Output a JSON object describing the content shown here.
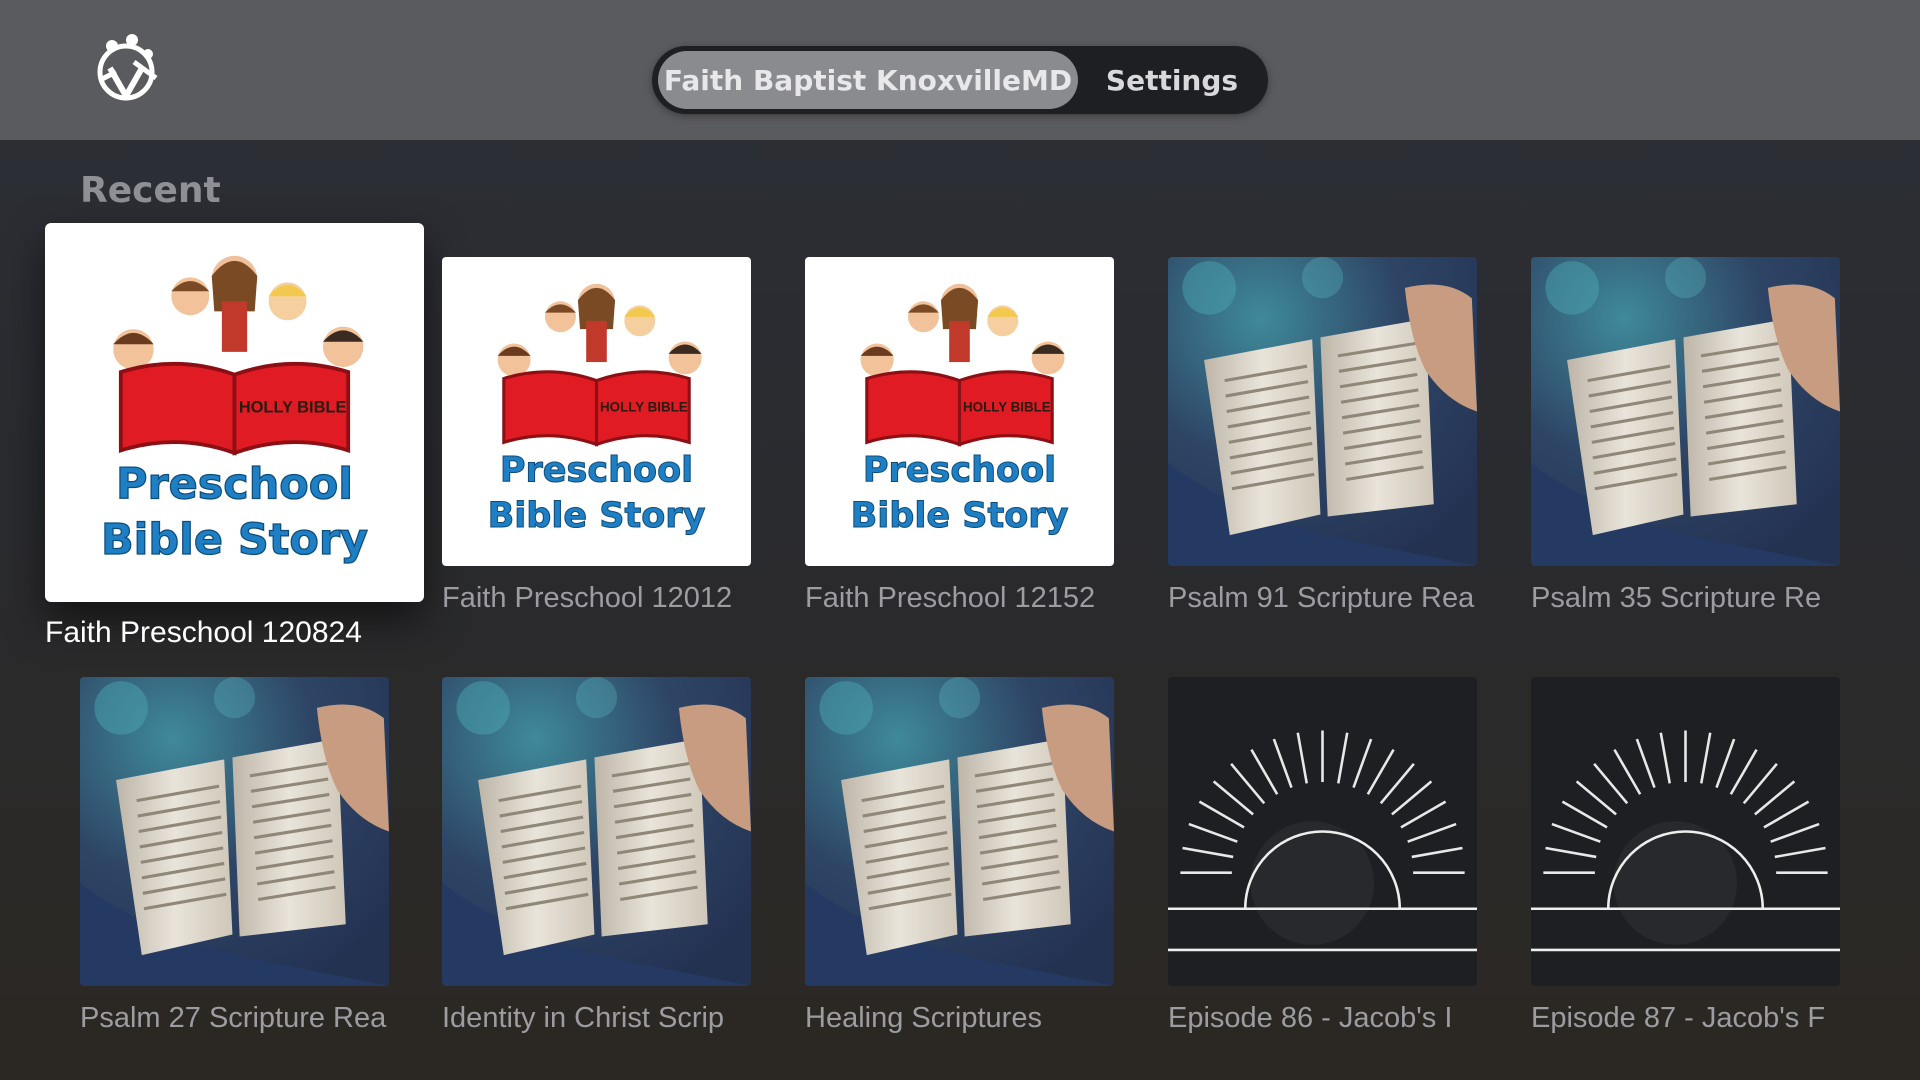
{
  "header": {
    "logo_icon": "church-people-logo-icon",
    "tabs": [
      {
        "label": "Faith Baptist KnoxvilleMD",
        "active": true
      },
      {
        "label": "Settings",
        "active": false
      }
    ]
  },
  "section": {
    "title": "Recent"
  },
  "items": [
    {
      "title": "Faith Preschool 120824",
      "art": "preschool",
      "art_line1": "Preschool",
      "art_line2": "Bible Story",
      "art_book": "HOLLY BIBLE",
      "focused": true
    },
    {
      "title": "Faith Preschool 12012",
      "art": "preschool",
      "art_line1": "Preschool",
      "art_line2": "Bible Story",
      "art_book": "HOLLY BIBLE",
      "focused": false
    },
    {
      "title": "Faith Preschool 12152",
      "art": "preschool",
      "art_line1": "Preschool",
      "art_line2": "Bible Story",
      "art_book": "HOLLY BIBLE",
      "focused": false
    },
    {
      "title": "Psalm 91 Scripture Rea",
      "art": "bible-photo",
      "focused": false
    },
    {
      "title": "Psalm 35 Scripture Re",
      "art": "bible-photo",
      "focused": false
    },
    {
      "title": "Psalm 27 Scripture Rea",
      "art": "bible-photo",
      "focused": false
    },
    {
      "title": "Identity in Christ Scrip",
      "art": "bible-photo",
      "focused": false
    },
    {
      "title": "Healing Scriptures",
      "art": "bible-photo",
      "focused": false
    },
    {
      "title": "Episode 86 - Jacob's I",
      "art": "sunrise",
      "focused": false
    },
    {
      "title": "Episode 87 - Jacob's F",
      "art": "sunrise",
      "focused": false
    }
  ]
}
